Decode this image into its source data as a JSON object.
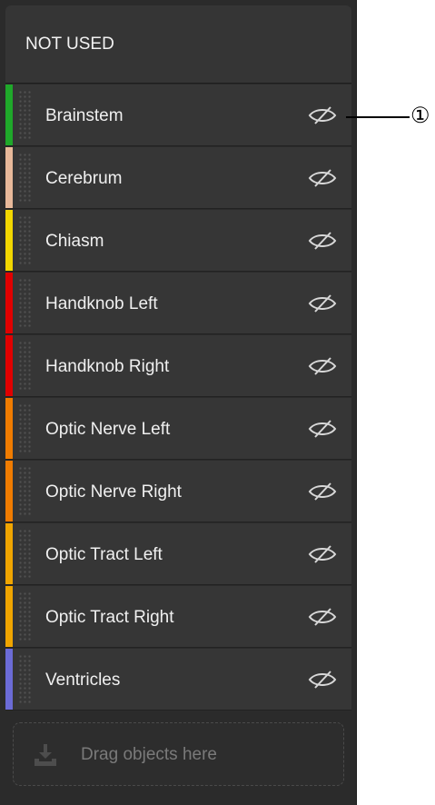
{
  "panel": {
    "title": "NOT USED"
  },
  "items": [
    {
      "label": "Brainstem",
      "color": "#1fa82a",
      "visibility_icon": "eye-off-icon"
    },
    {
      "label": "Cerebrum",
      "color": "#e8b99a",
      "visibility_icon": "eye-off-icon"
    },
    {
      "label": "Chiasm",
      "color": "#f2d700",
      "visibility_icon": "eye-off-icon"
    },
    {
      "label": "Handknob Left",
      "color": "#e00000",
      "visibility_icon": "eye-off-icon"
    },
    {
      "label": "Handknob Right",
      "color": "#e00000",
      "visibility_icon": "eye-off-icon"
    },
    {
      "label": "Optic Nerve Left",
      "color": "#f07c00",
      "visibility_icon": "eye-off-icon"
    },
    {
      "label": "Optic Nerve Right",
      "color": "#f07c00",
      "visibility_icon": "eye-off-icon"
    },
    {
      "label": "Optic Tract Left",
      "color": "#f0a500",
      "visibility_icon": "eye-off-icon"
    },
    {
      "label": "Optic Tract Right",
      "color": "#f0a500",
      "visibility_icon": "eye-off-icon"
    },
    {
      "label": "Ventricles",
      "color": "#6b6bd6",
      "visibility_icon": "eye-off-icon"
    }
  ],
  "drop_zone": {
    "label": "Drag objects here",
    "icon": "download-tray-icon"
  },
  "callout": {
    "number": "①"
  }
}
